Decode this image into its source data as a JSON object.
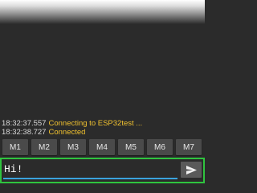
{
  "log": [
    {
      "timestamp": "18:32:37.557",
      "message": "Connecting to ESP32test ..."
    },
    {
      "timestamp": "18:32:38.727",
      "message": "Connected"
    }
  ],
  "macros": [
    "M1",
    "M2",
    "M3",
    "M4",
    "M5",
    "M6",
    "M7"
  ],
  "input": {
    "value": "Hi!"
  },
  "send": {
    "icon": "send-icon"
  },
  "colors": {
    "background": "#2b2b2b",
    "timestamp": "#d8d8d8",
    "status_message": "#f0c12f",
    "button": "#4a4a4a",
    "input_border": "#2fc43f",
    "input_underline": "#3aa3dd"
  }
}
